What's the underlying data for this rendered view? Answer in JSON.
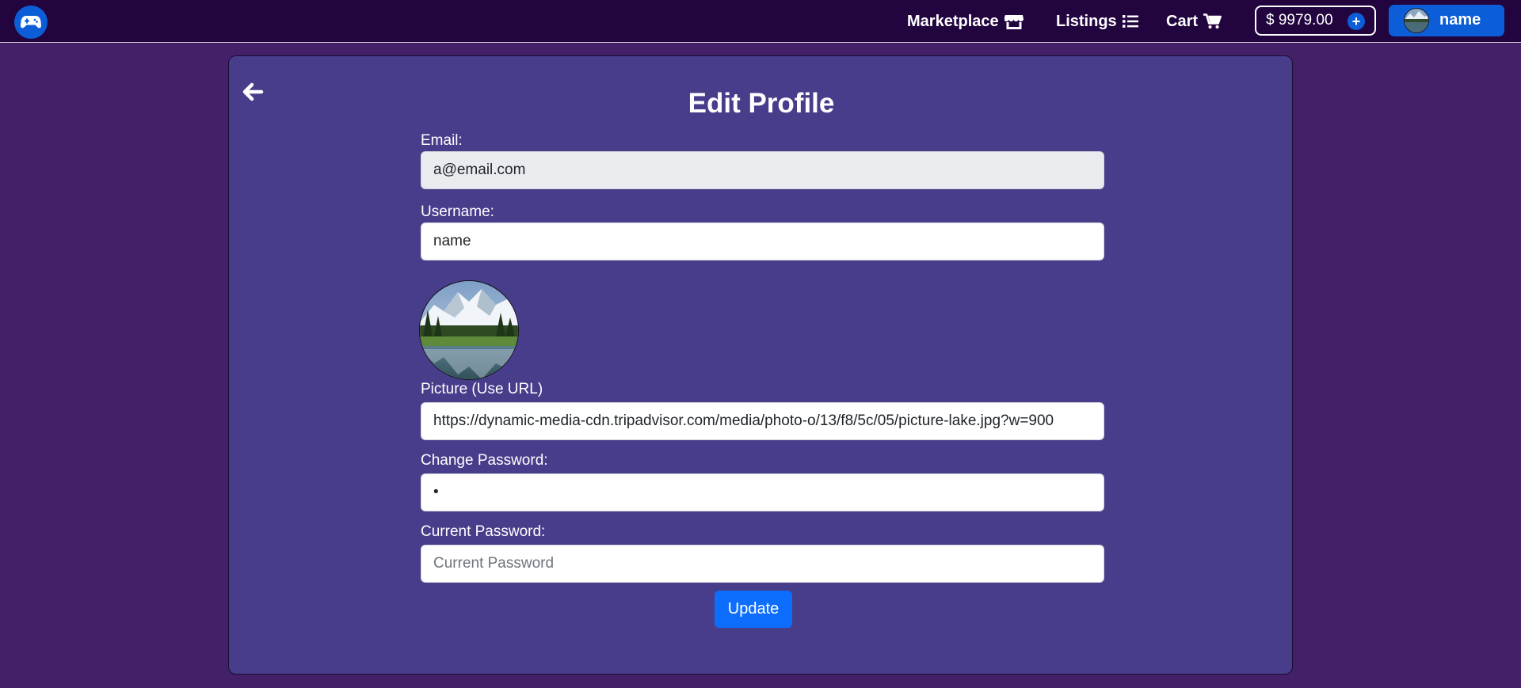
{
  "navbar": {
    "logo_icon": "gamepad-icon",
    "links": [
      {
        "label": "Marketplace",
        "icon": "store-icon"
      },
      {
        "label": "Listings",
        "icon": "list-icon"
      },
      {
        "label": "Cart",
        "icon": "cart-icon"
      }
    ],
    "balance": {
      "text": "$ 9979.00",
      "add_icon": "plus-circle-icon"
    },
    "user": {
      "name": "name",
      "avatar_icon": "avatar-icon"
    }
  },
  "card": {
    "back_icon": "arrow-left-icon",
    "title": "Edit Profile",
    "email": {
      "label": "Email:",
      "value": "a@email.com"
    },
    "username": {
      "label": "Username:",
      "value": "name"
    },
    "picture": {
      "label": "Picture (Use URL)",
      "value": "https://dynamic-media-cdn.tripadvisor.com/media/photo-o/13/f8/5c/05/picture-lake.jpg?w=900"
    },
    "change_password": {
      "label": "Change Password:",
      "value": "•"
    },
    "current_password": {
      "label": "Current Password:",
      "placeholder": "Current Password"
    },
    "update_label": "Update"
  },
  "colors": {
    "page_bg": "#432068",
    "navbar_bg": "#22053f",
    "card_bg": "#483d8b",
    "primary": "#0d6efd"
  }
}
